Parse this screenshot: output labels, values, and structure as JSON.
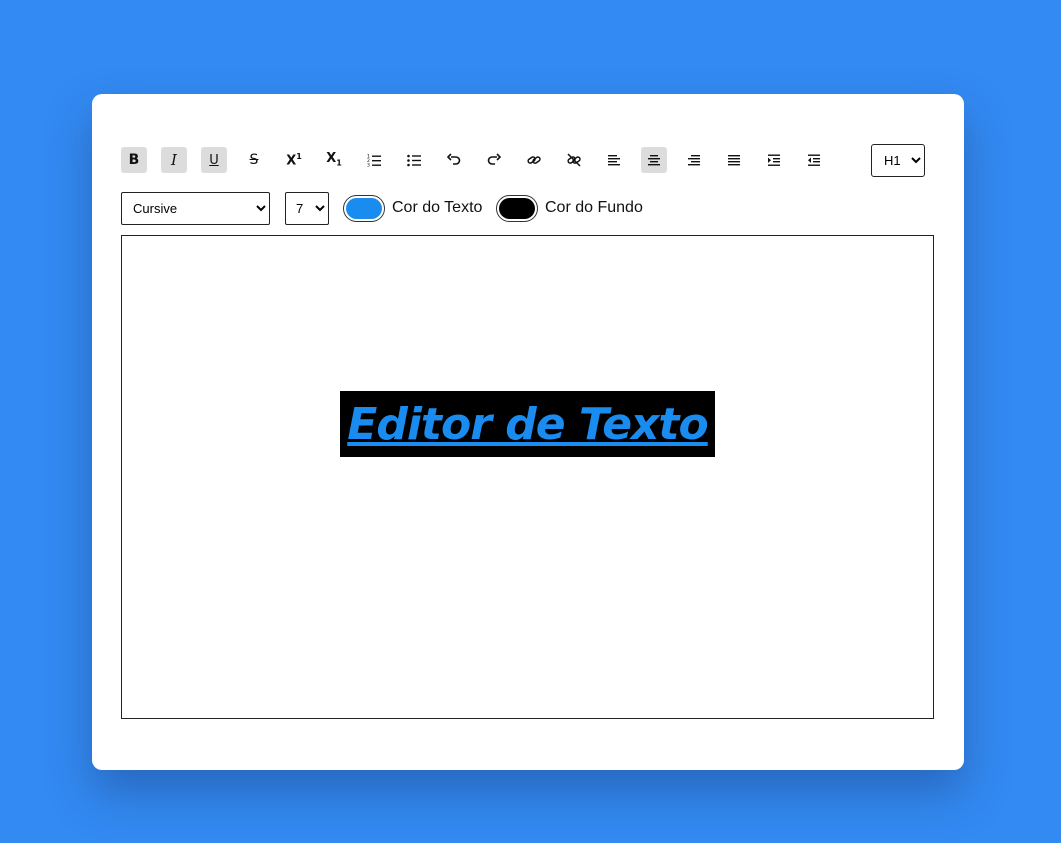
{
  "colors": {
    "page_background": "#338af2",
    "text_color": "#1a8cf0",
    "background_color": "#000000"
  },
  "toolbar": {
    "buttons": [
      {
        "icon": "bold-icon",
        "label": "B",
        "active": true
      },
      {
        "icon": "italic-icon",
        "label": "I",
        "active": true
      },
      {
        "icon": "underline-icon",
        "label": "U",
        "active": true
      },
      {
        "icon": "strikethrough-icon",
        "label": "",
        "active": false
      },
      {
        "icon": "superscript-icon",
        "label": "X",
        "active": false
      },
      {
        "icon": "subscript-icon",
        "label": "X",
        "active": false
      },
      {
        "icon": "ordered-list-icon",
        "label": "",
        "active": false
      },
      {
        "icon": "unordered-list-icon",
        "label": "",
        "active": false
      },
      {
        "icon": "undo-icon",
        "label": "",
        "active": false
      },
      {
        "icon": "redo-icon",
        "label": "",
        "active": false
      },
      {
        "icon": "link-icon",
        "label": "",
        "active": false
      },
      {
        "icon": "unlink-icon",
        "label": "",
        "active": false
      },
      {
        "icon": "align-left-icon",
        "label": "",
        "active": false
      },
      {
        "icon": "align-center-icon",
        "label": "",
        "active": true
      },
      {
        "icon": "align-right-icon",
        "label": "",
        "active": false
      },
      {
        "icon": "align-justify-icon",
        "label": "",
        "active": false
      },
      {
        "icon": "indent-icon",
        "label": "",
        "active": false
      },
      {
        "icon": "outdent-icon",
        "label": "",
        "active": false
      }
    ],
    "heading_select": {
      "value": "H1",
      "options": [
        "H1"
      ]
    }
  },
  "format": {
    "font_select": {
      "value": "Cursive",
      "options": [
        "Cursive"
      ]
    },
    "size_select": {
      "value": "7",
      "options": [
        "7"
      ]
    },
    "text_color_label": "Cor do Texto",
    "background_color_label": "Cor do Fundo"
  },
  "editor": {
    "content": "Editor de Texto"
  }
}
